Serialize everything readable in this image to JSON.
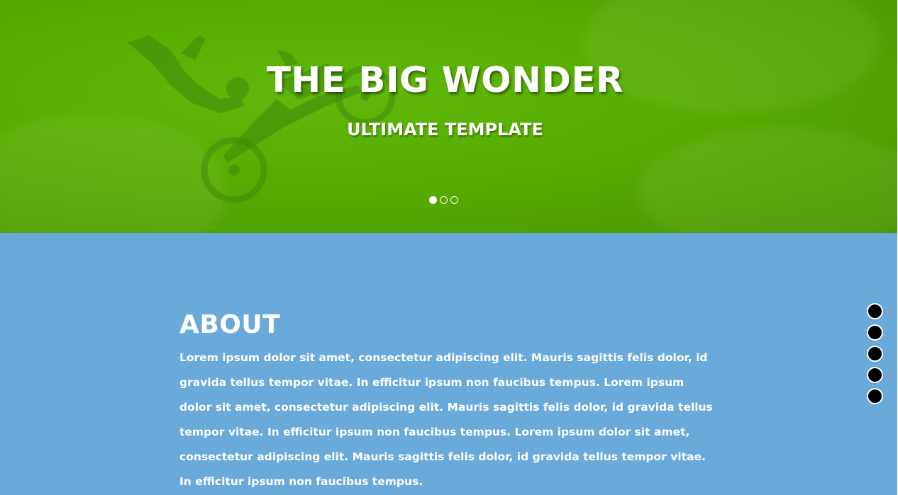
{
  "hero": {
    "title": "THE BIG WONDER",
    "subtitle": "ULTIMATE TEMPLATE",
    "background_color": "#56ad00",
    "slides": [
      {
        "active": true
      },
      {
        "active": false
      },
      {
        "active": false
      }
    ]
  },
  "about": {
    "heading": "ABOUT",
    "body": "Lorem ipsum dolor sit amet, consectetur adipiscing elit. Mauris sagittis felis dolor, id gravida tellus tempor vitae. In efficitur ipsum non faucibus tempus. Lorem ipsum dolor sit amet, consectetur adipiscing elit. Mauris sagittis felis dolor, id gravida tellus tempor vitae. In efficitur ipsum non faucibus tempus. Lorem ipsum dolor sit amet, consectetur adipiscing elit. Mauris sagittis felis dolor, id gravida tellus tempor vitae. In efficitur ipsum non faucibus tempus.",
    "background_color": "#69aadb"
  },
  "side_nav": {
    "count": 5,
    "dot_color": "#000000"
  },
  "icons": {
    "hero_image": "motocross-rider-image",
    "side_nav_dot": "nav-dot-icon"
  }
}
